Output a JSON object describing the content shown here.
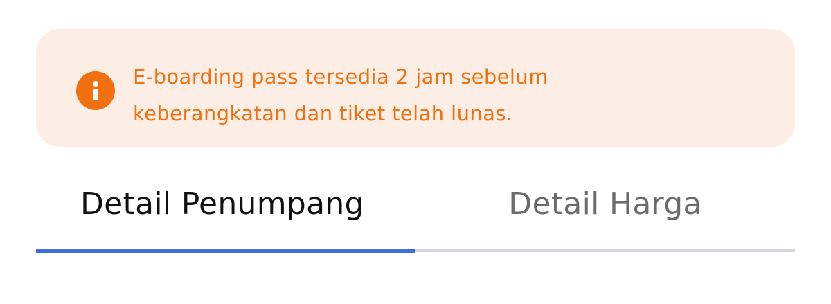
{
  "notice": {
    "icon": "info-icon",
    "text": "E-boarding pass tersedia 2 jam sebelum\nkeberangkatan dan tiket telah lunas.",
    "text_color": "#f2700f",
    "background_color": "#fdeee5"
  },
  "tabs": {
    "items": [
      {
        "label": "Detail Penumpang",
        "active": true
      },
      {
        "label": "Detail Harga",
        "active": false
      }
    ],
    "active_color": "#3e6fdb"
  }
}
